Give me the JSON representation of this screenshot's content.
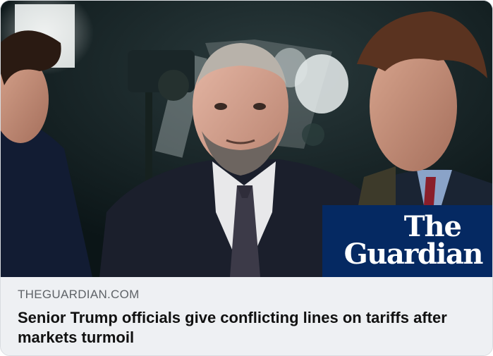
{
  "link_preview": {
    "image": {
      "description_icon": "news-photo",
      "logo": {
        "line1": "The",
        "line2": "Guardian",
        "background_color": "#052962",
        "text_color": "#ffffff"
      }
    },
    "domain": "THEGUARDIAN.COM",
    "headline": "Senior Trump officials give conflicting lines on tariffs after markets turmoil"
  },
  "colors": {
    "card_background": "#eef0f3",
    "domain_text": "#5f6368",
    "headline_text": "#111111"
  }
}
